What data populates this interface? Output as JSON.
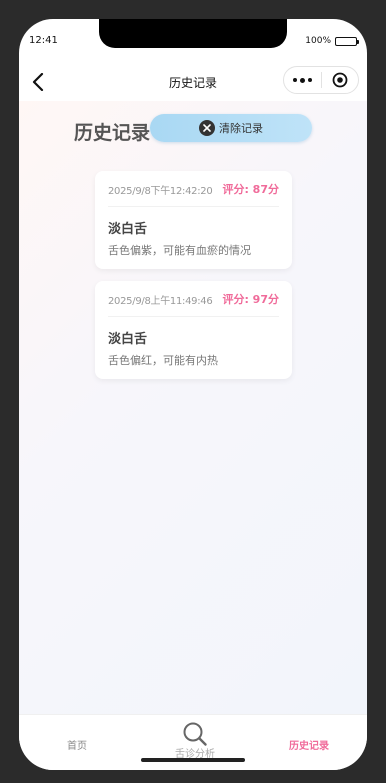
{
  "status": {
    "time": "12:41",
    "battery": "100%"
  },
  "navbar": {
    "title": "历史记录",
    "back_icon": "chevron-left-icon",
    "more_icon": "more-dots-icon",
    "close_icon": "target-circle-icon"
  },
  "page": {
    "heading": "历史记录",
    "clear_button": "清除记录",
    "clear_icon": "close-circle-icon"
  },
  "records": [
    {
      "time": "2025/9/8下午12:42:20",
      "score": "评分: 87分",
      "title": "淡白舌",
      "desc": "舌色偏紫，可能有血瘀的情况"
    },
    {
      "time": "2025/9/8上午11:49:46",
      "score": "评分: 97分",
      "title": "淡白舌",
      "desc": "舌色偏红，可能有内热"
    }
  ],
  "tabbar": {
    "home": "首页",
    "analyze": "舌诊分析",
    "analyze_icon": "search-icon",
    "history": "历史记录"
  },
  "colors": {
    "accent": "#f06b9a",
    "clear_button": "#b3dcf5"
  }
}
